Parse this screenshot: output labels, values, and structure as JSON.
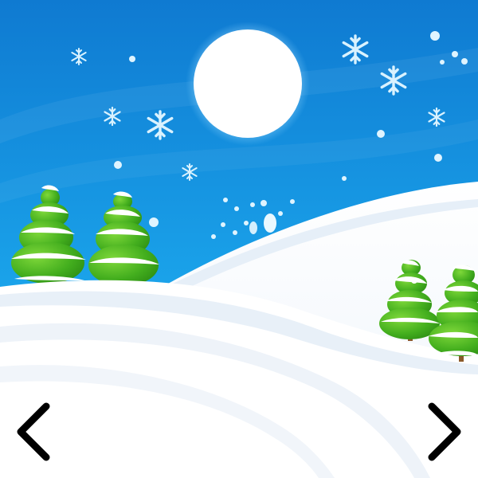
{
  "gallery": {
    "current_image": {
      "name": "winter-landscape",
      "elements": [
        "moon",
        "snowflake-icons",
        "snow-hills",
        "pine-trees"
      ]
    },
    "prev_icon": "chevron-left-icon",
    "next_icon": "chevron-right-icon"
  },
  "colors": {
    "sky_top": "#1282d6",
    "sky_bottom": "#19a6ea",
    "moon": "#ffffff",
    "snow": "#ffffff",
    "snow_shadow": "#dde8f3",
    "tree_green": "#4fba22",
    "tree_dark": "#2f8f16",
    "trunk": "#8a5a2b",
    "snowflake": "#cfeeff",
    "arrow": "#000000"
  }
}
